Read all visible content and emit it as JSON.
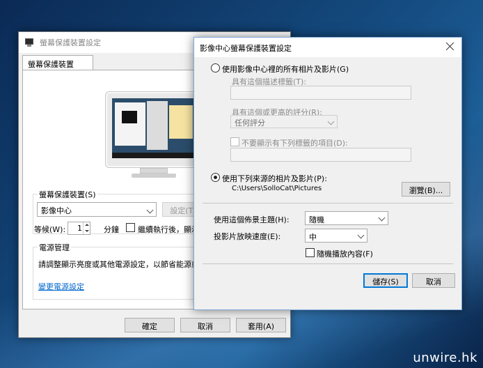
{
  "back_window": {
    "title": "螢幕保護裝置設定",
    "tab_label": "螢幕保護裝置",
    "screensaver_group_label": "螢幕保護裝置(S)",
    "screensaver_value": "影像中心",
    "settings_button": "設定(T)",
    "wait_label": "等候(W):",
    "wait_value": "1",
    "minutes_label": "分鐘",
    "resume_label": "繼續執行後，顯示登",
    "power_group_label": "電源管理",
    "power_desc": "請調整顯示亮度或其他電源設定，以節省能源或達",
    "change_power_link": "變更電源設定",
    "ok_button": "確定",
    "cancel_button": "取消",
    "apply_button": "套用(A)"
  },
  "dialog": {
    "title": "影像中心螢幕保護裝置設定",
    "opt_all_label": "使用影像中心裡的所有相片及影片(G)",
    "tags_label": "具有這個描述標籤(T):",
    "rating_label": "具有這個或更高的評分(R):",
    "rating_value": "任何評分",
    "exclude_label": "不要顯示有下列標籤的項目(D):",
    "opt_folder_label": "使用下列來源的相片及影片(P):",
    "folder_path": "C:\\Users\\SolloCat\\Pictures",
    "browse_button": "瀏覽(B)...",
    "theme_label": "使用這個佈景主題(H):",
    "theme_value": "隨機",
    "speed_label": "投影片放映速度(E):",
    "speed_value": "中",
    "shuffle_label": "隨機播放內容(F)",
    "save_button": "儲存(S)",
    "cancel_button": "取消"
  },
  "watermark": "unwire.hk"
}
